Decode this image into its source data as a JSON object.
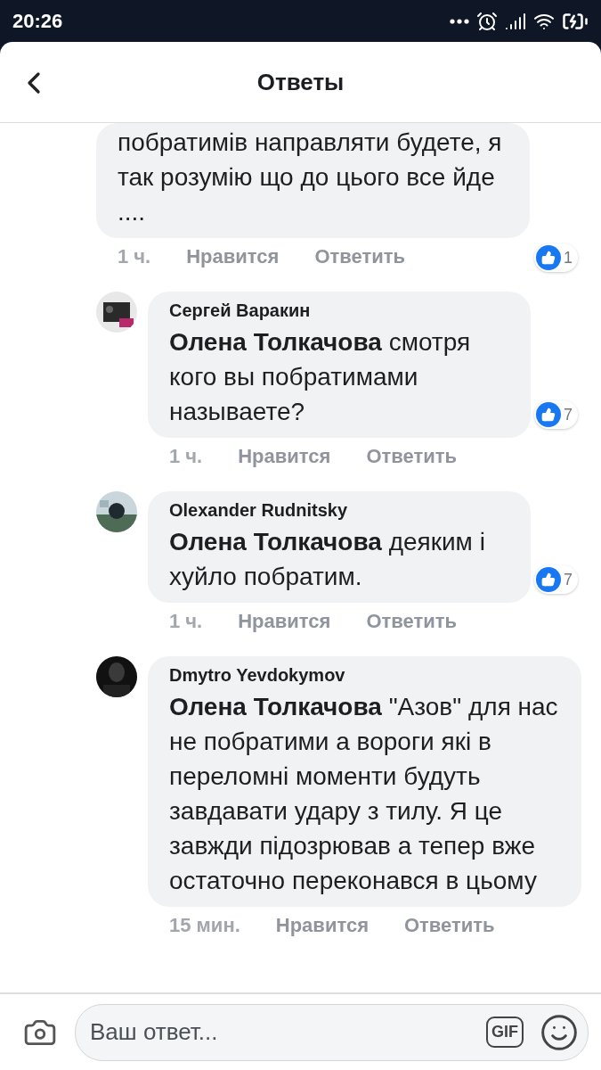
{
  "status_bar": {
    "time": "20:26"
  },
  "header": {
    "title": "Ответы"
  },
  "comments": [
    {
      "text": "побратимів направляти будете, я так розумію що до цього все йде ....",
      "time": "1 ч.",
      "like_label": "Нравится",
      "reply_label": "Ответить",
      "likes": "1"
    },
    {
      "author": "Сергей Варакин",
      "text": "**Олена Толкачова** смотря кого вы побратимами называете?",
      "time": "1 ч.",
      "like_label": "Нравится",
      "reply_label": "Ответить",
      "likes": "7"
    },
    {
      "author": "Olexander Rudnitsky",
      "text": "**Олена Толкачова** деяким і хуйло побратим.",
      "time": "1 ч.",
      "like_label": "Нравится",
      "reply_label": "Ответить",
      "likes": "7"
    },
    {
      "author": "Dmytro Yevdokymov",
      "text": "**Олена Толкачова** \"Азов\" для нас не побратими а вороги які в переломні моменти будуть завдавати удару з тилу. Я це завжди підозрював а тепер вже остаточно переконався в цьому",
      "time": "15 мин.",
      "like_label": "Нравится",
      "reply_label": "Ответить"
    }
  ],
  "composer": {
    "placeholder": "Ваш ответ...",
    "gif_label": "GIF"
  }
}
